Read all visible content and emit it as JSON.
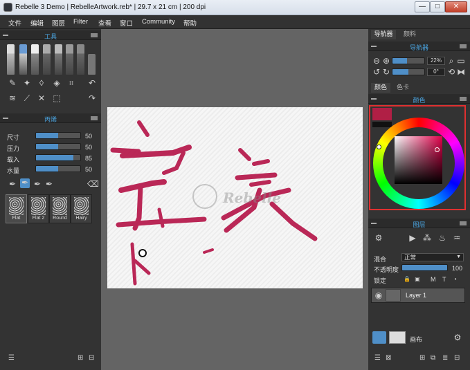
{
  "window": {
    "title": "Rebelle 3 Demo | RebelleArtwork.reb* | 29.7 x 21 cm | 200 dpi",
    "minimize": "—",
    "maximize": "□",
    "close": "✕"
  },
  "menubar": [
    "文件",
    "编辑",
    "图层",
    "Filter",
    "查看",
    "窗口",
    "Community",
    "帮助"
  ],
  "left": {
    "tools_title": "工具",
    "brush_title": "丙烯",
    "params": [
      {
        "label": "尺寸",
        "value": "50",
        "fill": 50
      },
      {
        "label": "压力",
        "value": "50",
        "fill": 50
      },
      {
        "label": "载入",
        "value": "85",
        "fill": 85
      },
      {
        "label": "水量",
        "value": "50",
        "fill": 50
      }
    ],
    "brushes": [
      "Flat",
      "Flat 2",
      "Round",
      "Hairy"
    ],
    "active_brush": "Flat"
  },
  "right": {
    "tabs": [
      "导航器",
      "颜料"
    ],
    "navigator_title": "导航器",
    "zoom": "22%",
    "rotation": "0°",
    "color_tabs": [
      "颜色",
      "色卡"
    ],
    "color_title": "颜色",
    "current_color": "#b01f45",
    "layers_title": "图层",
    "blend_label": "混合",
    "blend_value": "正常",
    "opacity_label": "不透明度",
    "opacity_value": "100",
    "lock_label": "锁定",
    "lock_letters": [
      "M",
      "T"
    ],
    "layer_name": "Layer 1",
    "canvas_label": "画布"
  },
  "canvas": {
    "watermark": "Rebelle",
    "paint_color": "#b5174a"
  }
}
